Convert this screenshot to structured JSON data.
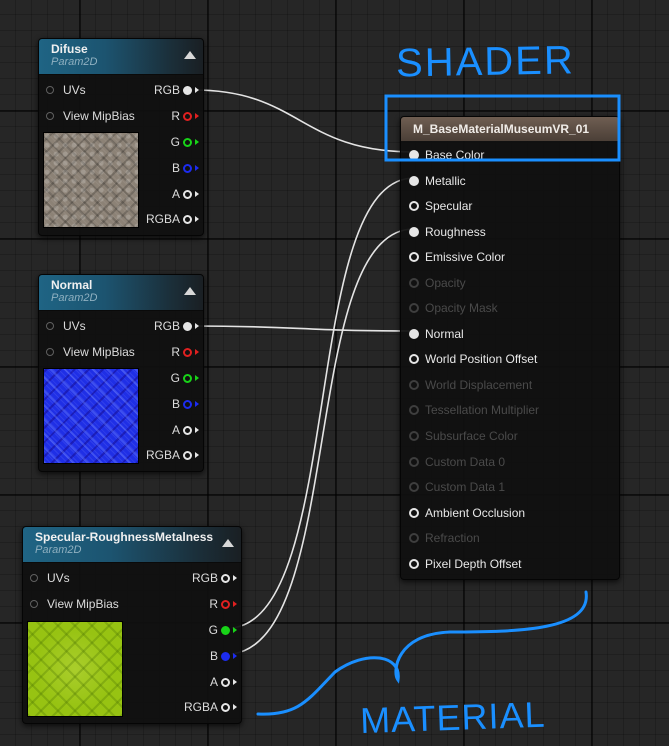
{
  "nodes": {
    "difuse": {
      "title": "Difuse",
      "subtitle": "Param2D",
      "inputs": [
        "UVs",
        "View MipBias"
      ],
      "outputs": [
        "RGB",
        "R",
        "G",
        "B",
        "A",
        "RGBA"
      ]
    },
    "normal": {
      "title": "Normal",
      "subtitle": "Param2D",
      "inputs": [
        "UVs",
        "View MipBias"
      ],
      "outputs": [
        "RGB",
        "R",
        "G",
        "B",
        "A",
        "RGBA"
      ]
    },
    "specular": {
      "title": "Specular-RoughnessMetalness",
      "subtitle": "Param2D",
      "inputs": [
        "UVs",
        "View MipBias"
      ],
      "outputs": [
        "RGB",
        "R",
        "G",
        "B",
        "A",
        "RGBA"
      ]
    }
  },
  "material": {
    "title": "M_BaseMaterialMuseumVR_01",
    "pins": [
      "Base Color",
      "Metallic",
      "Specular",
      "Roughness",
      "Emissive Color",
      "Opacity",
      "Opacity Mask",
      "Normal",
      "World Position Offset",
      "World Displacement",
      "Tessellation Multiplier",
      "Subsurface Color",
      "Custom Data 0",
      "Custom Data 1",
      "Ambient Occlusion",
      "Refraction",
      "Pixel Depth Offset"
    ]
  },
  "annotations": {
    "shader": "SHADER",
    "material": "MATERIAL"
  },
  "colors": {
    "pin_red": "#e02020",
    "pin_green": "#18d418",
    "pin_blue": "#1c2cf0",
    "wire": "#e4e4e4",
    "annotation": "#1a8fff"
  }
}
